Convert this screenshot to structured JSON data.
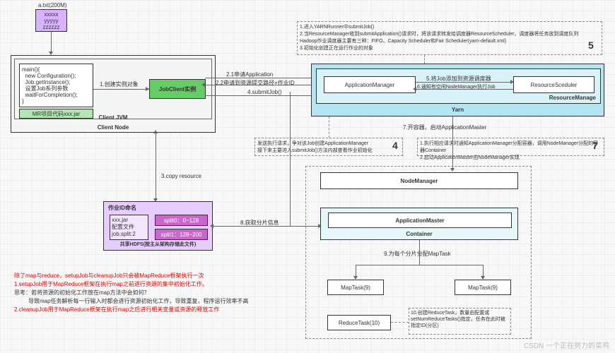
{
  "file": {
    "name": "a.txt(200M)",
    "line1": "xxxxx",
    "line2": "yyyyy",
    "line3": "zzzzzz"
  },
  "clientNode": {
    "title": "Client Node",
    "jvm": "Client JVM",
    "main": "main(){\n  new Configuration();\n  Job.getInstance();\n  设置Job系列参数\n  waitForCompletion();\n}",
    "jar": "MR项目代码xxx.jar",
    "jobClient": "JobClient实例",
    "step1": "1.创建实例对象"
  },
  "steps": {
    "s2_1": "2.1申请Application",
    "s2_2": "2.2申请到资源提交路径+作业ID",
    "s3": "3.copy resource",
    "s4": "4.submitJob()",
    "s7": "7.开容器，启动ApplicationMaster",
    "s8": "8.获取分片信息",
    "s9": "9.为每个分片分配MapTask"
  },
  "hdfs": {
    "title": "作业ID命名",
    "item1": "xxx.jar\n配置文件\njob.split:2",
    "split0": "split0：0~128",
    "split1": "split1：128~200",
    "footer": "共享HDFS(按主从架构存储此文件)"
  },
  "yarn": {
    "title": "Yarn",
    "rm": "ResourceManage",
    "appMgr": "ApplicationManager",
    "rs": "ResourceSceduler",
    "step5": "5.将Job添加到资源调度器",
    "step6": "6.通知有空闲NodeManager执行Job"
  },
  "note4": "发送执行请求，争对该Job创建ApplicationManager\n接下来主要进入submitJob()方法内部查看作业初始化",
  "note5": "1.进入YARNRunner中submitJob()\n2.当ResourceManager收到submitApplication()请求时，将该请求转发给调度器ResourceScheduler，调度器将任务放到调度队列\nHadoop作业调度器主要有三种：FIFO、Capacity Scheduler和Fair Scheduler(yarn-default.xml)\n3.初始化创建正在运行作业的对象",
  "note7": "1.执行相应请求时通知ApplicationManager分配容器，调用NodeManager分配的容器Container\n2.启动ApplicationMaster由NodeManager实现",
  "note10": "10.创建ReduceTask，数量由配置或setNumReduceTasks()指定，任务在此时被指定ID(分区)",
  "container": {
    "nm": "NodeManager",
    "am": "ApplicationMaster",
    "title": "Container",
    "map1": "MapTask(9)",
    "map2": "MapTask(9)",
    "reduce": "ReduceTask(10)"
  },
  "badges": {
    "b4": "4",
    "b5": "5",
    "b7": "7"
  },
  "bottomNote": {
    "l1": "除了map与reduce，setupJob与cleanupJob只会被MapReduce框架执行一次",
    "l2": "1.setupJob用于MapReduce框架在执行map之前进行资源的集中初始化工作。",
    "l3": "思考：若将资源的初始化工作放在map方法中会如何？",
    "l4": "导致map任务解析每一行输入时都会进行资源初始化工作，导致重复，程序运行效率不高",
    "l5": "2.cleanupJob用于MapReduce框架在执行map之后进行相关变量或资源的释放工作"
  },
  "watermark": "CSDN 一个正在努力的菜鸡"
}
